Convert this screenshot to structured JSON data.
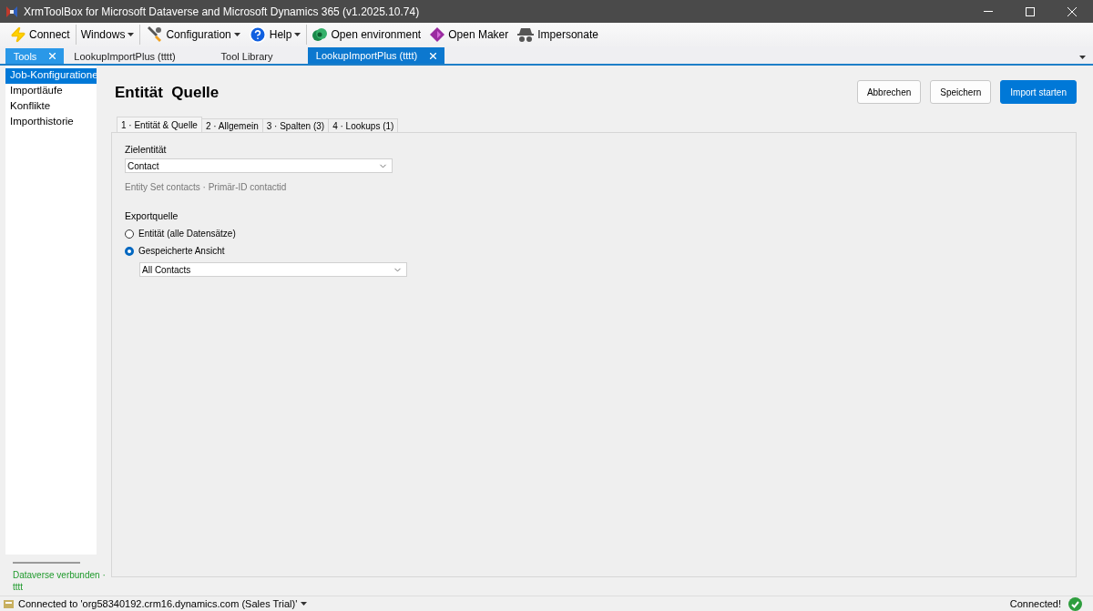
{
  "window": {
    "title": "XrmToolBox for Microsoft Dataverse and Microsoft Dynamics 365 (v1.2025.10.74)"
  },
  "toolbar": [
    {
      "label": "Connect",
      "dropdown": false,
      "separator_after": true
    },
    {
      "label": "Windows",
      "dropdown": true,
      "separator_after": true
    },
    {
      "label": "Configuration",
      "dropdown": true,
      "separator_after": false
    },
    {
      "label": "Help",
      "dropdown": true,
      "separator_after": true
    },
    {
      "label": "Open environment",
      "dropdown": false,
      "separator_after": false
    },
    {
      "label": "Open Maker",
      "dropdown": false,
      "separator_after": false
    },
    {
      "label": "Impersonate",
      "dropdown": false,
      "separator_after": false
    }
  ],
  "doc_tabs": [
    {
      "label": "Tools",
      "kind": "pinned",
      "selected": false,
      "closable": true
    },
    {
      "label": "LookupImportPlus (tttt)",
      "kind": "document",
      "selected": false,
      "closable": false
    },
    {
      "label": "Tool Library",
      "kind": "document",
      "selected": false,
      "closable": false
    },
    {
      "label": "LookupImportPlus (tttt)",
      "kind": "document",
      "selected": true,
      "closable": true
    }
  ],
  "sidebar": {
    "items": [
      {
        "label": "Job-Konfiguratione",
        "selected": true
      },
      {
        "label": "Importläufe",
        "selected": false
      },
      {
        "label": "Konflikte",
        "selected": false
      },
      {
        "label": "Importhistorie",
        "selected": false
      }
    ],
    "status": "Dataverse verbunden · tttt"
  },
  "heading": "Entität  Quelle",
  "actions": [
    {
      "label": "Abbrechen",
      "kind": "default"
    },
    {
      "label": "Speichern",
      "kind": "default"
    },
    {
      "label": "Import starten",
      "kind": "primary"
    }
  ],
  "tabs": [
    {
      "label": "1 · Entität & Quelle",
      "selected": true
    },
    {
      "label": "2 · Allgemein",
      "selected": false
    },
    {
      "label": "3 · Spalten (3)",
      "selected": false
    },
    {
      "label": "4 · Lookups (1)",
      "selected": false
    }
  ],
  "form": {
    "target_label": "Zielentität",
    "target_value": "Contact",
    "target_info": "Entity Set contacts · Primär-ID contactid",
    "source_label": "Exportquelle",
    "source_options": [
      {
        "label": "Entität (alle Datensätze)",
        "selected": false
      },
      {
        "label": "Gespeicherte Ansicht",
        "selected": true
      }
    ],
    "view_value": "All Contacts"
  },
  "status_bar": {
    "text": "Connected to 'org58340192.crm16.dynamics.com (Sales Trial)'",
    "right": "Connected!"
  }
}
